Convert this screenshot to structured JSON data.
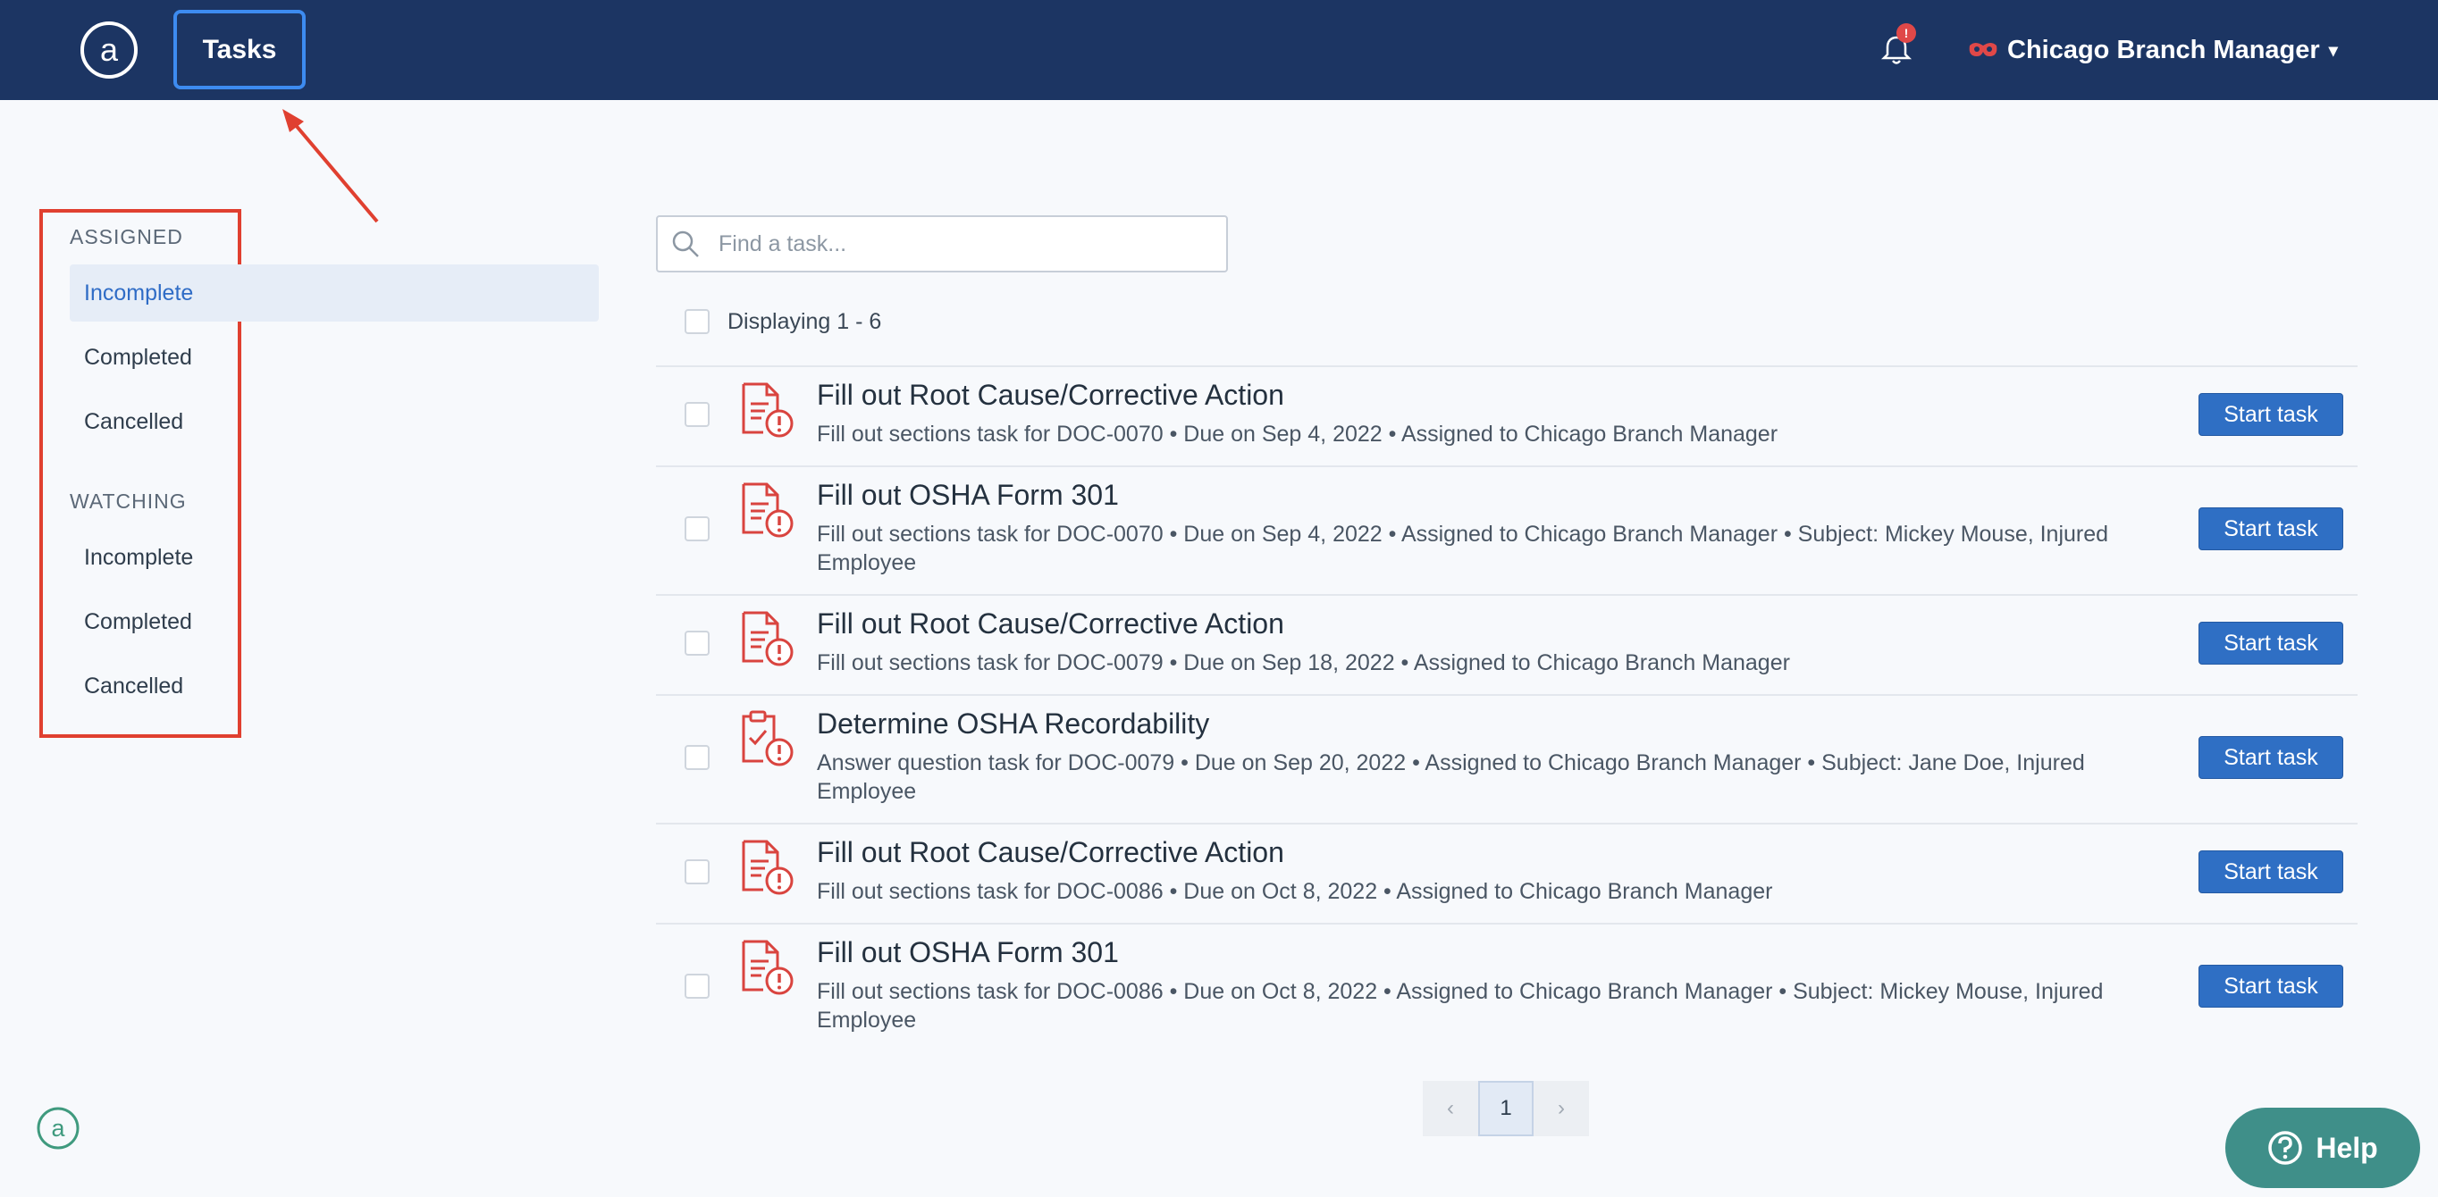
{
  "header": {
    "tab_label": "Tasks",
    "notification_badge": "!",
    "user_name": "Chicago Branch Manager"
  },
  "sidebar": {
    "assigned_heading": "ASSIGNED",
    "assigned_items": [
      {
        "label": "Incomplete",
        "active": true
      },
      {
        "label": "Completed",
        "active": false
      },
      {
        "label": "Cancelled",
        "active": false
      }
    ],
    "watching_heading": "WATCHING",
    "watching_items": [
      {
        "label": "Incomplete",
        "active": false
      },
      {
        "label": "Completed",
        "active": false
      },
      {
        "label": "Cancelled",
        "active": false
      }
    ]
  },
  "search": {
    "placeholder": "Find a task..."
  },
  "list": {
    "displaying": "Displaying 1 - 6",
    "start_label": "Start task",
    "tasks": [
      {
        "title": "Fill out Root Cause/Corrective Action",
        "meta": "Fill out sections task for DOC-0070  •  Due on Sep 4, 2022  •  Assigned to Chicago Branch Manager",
        "icon": "document-alert-icon"
      },
      {
        "title": "Fill out OSHA Form 301",
        "meta": "Fill out sections task for DOC-0070  •  Due on Sep 4, 2022  •  Assigned to Chicago Branch Manager  •  Subject: Mickey Mouse, Injured Employee",
        "icon": "document-alert-icon"
      },
      {
        "title": "Fill out Root Cause/Corrective Action",
        "meta": "Fill out sections task for DOC-0079  •  Due on Sep 18, 2022  •  Assigned to Chicago Branch Manager",
        "icon": "document-alert-icon"
      },
      {
        "title": "Determine OSHA Recordability",
        "meta": "Answer question task for DOC-0079  •  Due on Sep 20, 2022  •  Assigned to Chicago Branch Manager  •  Subject: Jane Doe, Injured Employee",
        "icon": "clipboard-alert-icon"
      },
      {
        "title": "Fill out Root Cause/Corrective Action",
        "meta": "Fill out sections task for DOC-0086  •  Due on Oct 8, 2022  •  Assigned to Chicago Branch Manager",
        "icon": "document-alert-icon"
      },
      {
        "title": "Fill out OSHA Form 301",
        "meta": "Fill out sections task for DOC-0086  •  Due on Oct 8, 2022  •  Assigned to Chicago Branch Manager  •  Subject: Mickey Mouse, Injured Employee",
        "icon": "document-alert-icon"
      }
    ]
  },
  "pagination": {
    "prev": "‹",
    "current": "1",
    "next": "›"
  },
  "help": {
    "label": "Help"
  },
  "colors": {
    "nav": "#1c3563",
    "accent": "#2f6fc4",
    "alert": "#d9443f",
    "help": "#3f8f89"
  }
}
